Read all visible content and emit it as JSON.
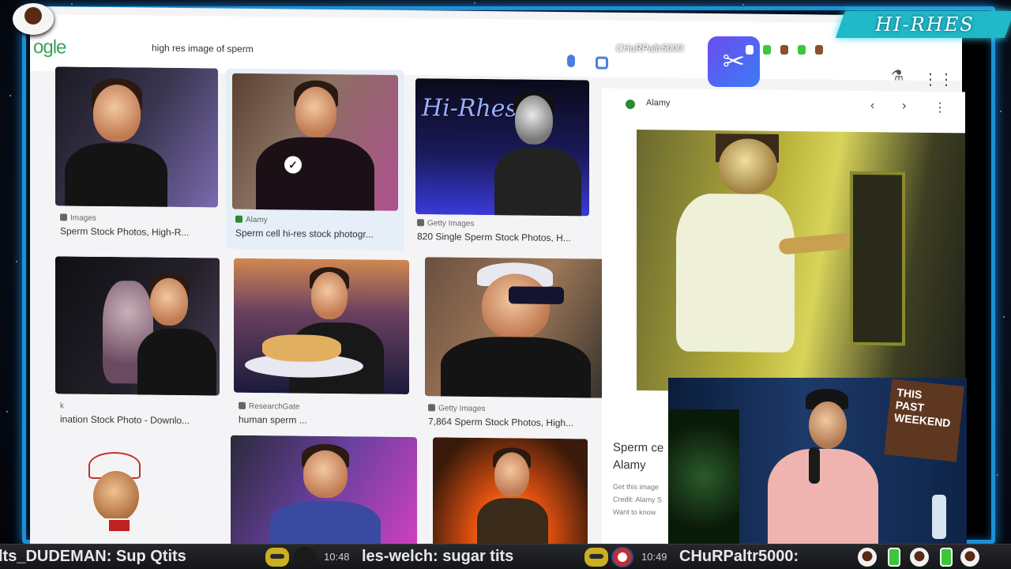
{
  "browser": {
    "logo": "ogle",
    "search_query": "high res image of sperm"
  },
  "results": [
    {
      "source": "Images",
      "title": "Sperm Stock Photos, High-R..."
    },
    {
      "source": "Alamy",
      "title": "Sperm cell hi-res stock photogr..."
    },
    {
      "source": "Getty Images",
      "title": "820 Single Sperm Stock Photos, H..."
    },
    {
      "source": "k",
      "title": "ination Stock Photo - Downlo..."
    },
    {
      "source": "ResearchGate",
      "title": "human sperm ..."
    },
    {
      "source": "Getty Images",
      "title": "7,864 Sperm Stock Photos, High..."
    }
  ],
  "tile3_overlay_text": "Hi-Rhes",
  "panel": {
    "source": "Alamy",
    "title_line1": "Sperm ce",
    "title_line2": "Alamy",
    "meta_line1": "Get this image",
    "meta_line2": "Credit: Alamy S",
    "meta_line3": "Want to know"
  },
  "overlay": {
    "brand": "HI-RHES",
    "top_chat": "CHuRPaltr5000:",
    "capcut_glyph": "✂"
  },
  "podcast_sign": [
    "THIS",
    "PAST",
    "WEEKEND"
  ],
  "chat": [
    {
      "user": "lts_DUDEMAN",
      "text": "Sup Qtits",
      "time": ""
    },
    {
      "user": "les-welch",
      "text": "sugar tits",
      "time": "10:48"
    },
    {
      "user": "CHuRPaltr5000",
      "text": "",
      "time": "10:49"
    }
  ],
  "colors": {
    "frame": "#1d8fd6",
    "brand_bg": "#1fb9c9",
    "chat_bg": "#1c1d21",
    "badge": "#c9b020"
  }
}
